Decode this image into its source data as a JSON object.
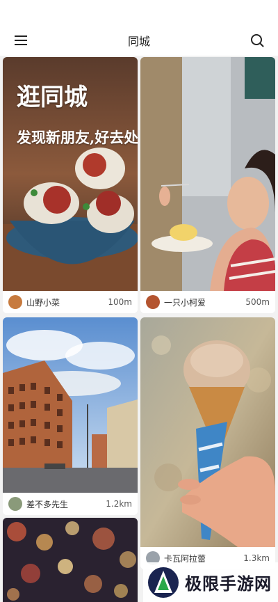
{
  "header": {
    "title": "同城",
    "menu_icon": "menu-icon",
    "search_icon": "search-icon"
  },
  "cards": [
    {
      "overlay_line1": "逛同城",
      "overlay_line2": "发现新朋友,好去处",
      "user": "山野小菜",
      "distance": "100m"
    },
    {
      "user": "一只小柯爱",
      "distance": "500m"
    },
    {
      "user": "差不多先生",
      "distance": "1.2km"
    },
    {
      "user": "卡瓦阿拉蕾",
      "distance": "1.3km"
    }
  ],
  "watermark": {
    "text": "极限手游网"
  },
  "colors": {
    "header_bg": "#ffffff",
    "page_bg": "#f2f2f2"
  }
}
